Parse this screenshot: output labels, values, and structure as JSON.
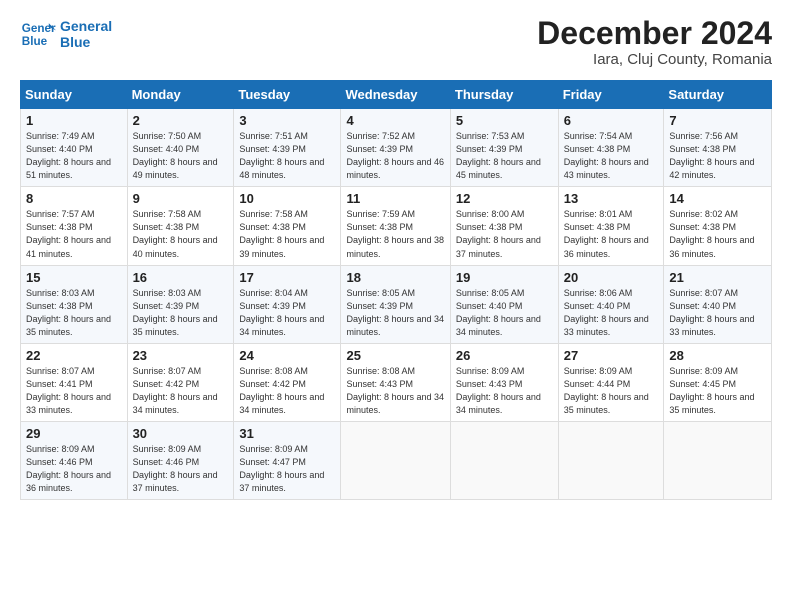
{
  "header": {
    "logo_line1": "General",
    "logo_line2": "Blue",
    "month": "December 2024",
    "location": "Iara, Cluj County, Romania"
  },
  "days_of_week": [
    "Sunday",
    "Monday",
    "Tuesday",
    "Wednesday",
    "Thursday",
    "Friday",
    "Saturday"
  ],
  "weeks": [
    [
      {
        "day": "1",
        "sunrise": "7:49 AM",
        "sunset": "4:40 PM",
        "daylight": "8 hours and 51 minutes."
      },
      {
        "day": "2",
        "sunrise": "7:50 AM",
        "sunset": "4:40 PM",
        "daylight": "8 hours and 49 minutes."
      },
      {
        "day": "3",
        "sunrise": "7:51 AM",
        "sunset": "4:39 PM",
        "daylight": "8 hours and 48 minutes."
      },
      {
        "day": "4",
        "sunrise": "7:52 AM",
        "sunset": "4:39 PM",
        "daylight": "8 hours and 46 minutes."
      },
      {
        "day": "5",
        "sunrise": "7:53 AM",
        "sunset": "4:39 PM",
        "daylight": "8 hours and 45 minutes."
      },
      {
        "day": "6",
        "sunrise": "7:54 AM",
        "sunset": "4:38 PM",
        "daylight": "8 hours and 43 minutes."
      },
      {
        "day": "7",
        "sunrise": "7:56 AM",
        "sunset": "4:38 PM",
        "daylight": "8 hours and 42 minutes."
      }
    ],
    [
      {
        "day": "8",
        "sunrise": "7:57 AM",
        "sunset": "4:38 PM",
        "daylight": "8 hours and 41 minutes."
      },
      {
        "day": "9",
        "sunrise": "7:58 AM",
        "sunset": "4:38 PM",
        "daylight": "8 hours and 40 minutes."
      },
      {
        "day": "10",
        "sunrise": "7:58 AM",
        "sunset": "4:38 PM",
        "daylight": "8 hours and 39 minutes."
      },
      {
        "day": "11",
        "sunrise": "7:59 AM",
        "sunset": "4:38 PM",
        "daylight": "8 hours and 38 minutes."
      },
      {
        "day": "12",
        "sunrise": "8:00 AM",
        "sunset": "4:38 PM",
        "daylight": "8 hours and 37 minutes."
      },
      {
        "day": "13",
        "sunrise": "8:01 AM",
        "sunset": "4:38 PM",
        "daylight": "8 hours and 36 minutes."
      },
      {
        "day": "14",
        "sunrise": "8:02 AM",
        "sunset": "4:38 PM",
        "daylight": "8 hours and 36 minutes."
      }
    ],
    [
      {
        "day": "15",
        "sunrise": "8:03 AM",
        "sunset": "4:38 PM",
        "daylight": "8 hours and 35 minutes."
      },
      {
        "day": "16",
        "sunrise": "8:03 AM",
        "sunset": "4:39 PM",
        "daylight": "8 hours and 35 minutes."
      },
      {
        "day": "17",
        "sunrise": "8:04 AM",
        "sunset": "4:39 PM",
        "daylight": "8 hours and 34 minutes."
      },
      {
        "day": "18",
        "sunrise": "8:05 AM",
        "sunset": "4:39 PM",
        "daylight": "8 hours and 34 minutes."
      },
      {
        "day": "19",
        "sunrise": "8:05 AM",
        "sunset": "4:40 PM",
        "daylight": "8 hours and 34 minutes."
      },
      {
        "day": "20",
        "sunrise": "8:06 AM",
        "sunset": "4:40 PM",
        "daylight": "8 hours and 33 minutes."
      },
      {
        "day": "21",
        "sunrise": "8:07 AM",
        "sunset": "4:40 PM",
        "daylight": "8 hours and 33 minutes."
      }
    ],
    [
      {
        "day": "22",
        "sunrise": "8:07 AM",
        "sunset": "4:41 PM",
        "daylight": "8 hours and 33 minutes."
      },
      {
        "day": "23",
        "sunrise": "8:07 AM",
        "sunset": "4:42 PM",
        "daylight": "8 hours and 34 minutes."
      },
      {
        "day": "24",
        "sunrise": "8:08 AM",
        "sunset": "4:42 PM",
        "daylight": "8 hours and 34 minutes."
      },
      {
        "day": "25",
        "sunrise": "8:08 AM",
        "sunset": "4:43 PM",
        "daylight": "8 hours and 34 minutes."
      },
      {
        "day": "26",
        "sunrise": "8:09 AM",
        "sunset": "4:43 PM",
        "daylight": "8 hours and 34 minutes."
      },
      {
        "day": "27",
        "sunrise": "8:09 AM",
        "sunset": "4:44 PM",
        "daylight": "8 hours and 35 minutes."
      },
      {
        "day": "28",
        "sunrise": "8:09 AM",
        "sunset": "4:45 PM",
        "daylight": "8 hours and 35 minutes."
      }
    ],
    [
      {
        "day": "29",
        "sunrise": "8:09 AM",
        "sunset": "4:46 PM",
        "daylight": "8 hours and 36 minutes."
      },
      {
        "day": "30",
        "sunrise": "8:09 AM",
        "sunset": "4:46 PM",
        "daylight": "8 hours and 37 minutes."
      },
      {
        "day": "31",
        "sunrise": "8:09 AM",
        "sunset": "4:47 PM",
        "daylight": "8 hours and 37 minutes."
      },
      null,
      null,
      null,
      null
    ]
  ]
}
